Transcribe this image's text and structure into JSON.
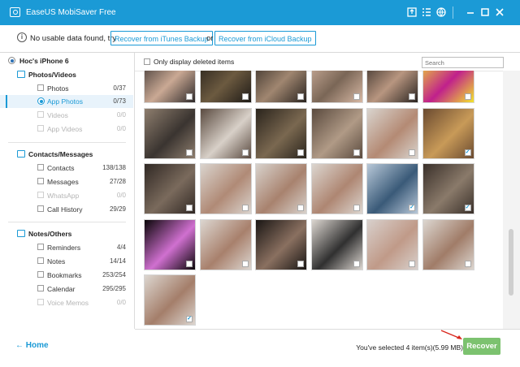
{
  "window": {
    "title": "EaseUS MobiSaver Free",
    "accent": "#1b9ad6"
  },
  "info_bar": {
    "message": "No usable data found, try",
    "itunes_button": "Recover from iTunes Backup",
    "or": "or",
    "icloud_button": "Recover from iCloud Backup"
  },
  "sidebar": {
    "device": "Hoc's iPhone 6",
    "groups": [
      {
        "name": "Photos/Videos",
        "icon": "photo-icon",
        "items": [
          {
            "label": "Photos",
            "count": "0/37",
            "enabled": true,
            "active": false
          },
          {
            "label": "App Photos",
            "count": "0/73",
            "enabled": true,
            "active": true
          },
          {
            "label": "Videos",
            "count": "0/0",
            "enabled": false,
            "active": false
          },
          {
            "label": "App Videos",
            "count": "0/0",
            "enabled": false,
            "active": false
          }
        ]
      },
      {
        "name": "Contacts/Messages",
        "icon": "contacts-icon",
        "items": [
          {
            "label": "Contacts",
            "count": "138/138",
            "enabled": true
          },
          {
            "label": "Messages",
            "count": "27/28",
            "enabled": true
          },
          {
            "label": "WhatsApp",
            "count": "0/0",
            "enabled": false
          },
          {
            "label": "Call History",
            "count": "29/29",
            "enabled": true
          }
        ]
      },
      {
        "name": "Notes/Others",
        "icon": "notes-icon",
        "items": [
          {
            "label": "Reminders",
            "count": "4/4",
            "enabled": true
          },
          {
            "label": "Notes",
            "count": "14/14",
            "enabled": true
          },
          {
            "label": "Bookmarks",
            "count": "253/254",
            "enabled": true
          },
          {
            "label": "Calendar",
            "count": "295/295",
            "enabled": true
          },
          {
            "label": "Voice Memos",
            "count": "0/0",
            "enabled": false
          }
        ]
      }
    ],
    "home_label": "Home"
  },
  "content": {
    "filter_label": "Only display deleted items",
    "search_placeholder": "Search",
    "thumbnails": [
      {
        "colors": [
          "#2e2a2a",
          "#caa994"
        ],
        "checked": false
      },
      {
        "colors": [
          "#1e1a16",
          "#6c5a40"
        ],
        "checked": false
      },
      {
        "colors": [
          "#2b2520",
          "#a08670"
        ],
        "checked": false
      },
      {
        "colors": [
          "#d7b8a4",
          "#7a6656"
        ],
        "checked": false
      },
      {
        "colors": [
          "#2a2420",
          "#b89680"
        ],
        "checked": false
      },
      {
        "colors": [
          "#f2e52b",
          "#c0208c"
        ],
        "checked": false
      },
      {
        "colors": [
          "#8e7e6e",
          "#3a3430"
        ],
        "checked": false
      },
      {
        "colors": [
          "#5a4a40",
          "#d8d0c8"
        ],
        "checked": false
      },
      {
        "colors": [
          "#2a241c",
          "#7a6850"
        ],
        "checked": false
      },
      {
        "colors": [
          "#5a4a3e",
          "#b09a86"
        ],
        "checked": false
      },
      {
        "colors": [
          "#d9d4ce",
          "#b48a74"
        ],
        "checked": false
      },
      {
        "colors": [
          "#6a4a30",
          "#c89a58"
        ],
        "checked": true
      },
      {
        "colors": [
          "#302824",
          "#7a6a5c"
        ],
        "checked": false
      },
      {
        "colors": [
          "#dad4ce",
          "#b08a76"
        ],
        "checked": false
      },
      {
        "colors": [
          "#d8d2cc",
          "#a8826e"
        ],
        "checked": false
      },
      {
        "colors": [
          "#dcd6d0",
          "#ae8672"
        ],
        "checked": false
      },
      {
        "colors": [
          "#b8c8d8",
          "#3a5a78"
        ],
        "checked": true
      },
      {
        "colors": [
          "#3a302a",
          "#8a7a6a"
        ],
        "checked": true
      },
      {
        "colors": [
          "#0a0608",
          "#d070d0"
        ],
        "checked": false
      },
      {
        "colors": [
          "#dcd6d0",
          "#a8806c"
        ],
        "checked": false
      },
      {
        "colors": [
          "#1a1614",
          "#8a7060"
        ],
        "checked": false
      },
      {
        "colors": [
          "#dcd6d0",
          "#303030"
        ],
        "checked": false
      },
      {
        "colors": [
          "#d8d0cc",
          "#c09a88"
        ],
        "checked": false
      },
      {
        "colors": [
          "#dcd6d0",
          "#a07c68"
        ],
        "checked": false
      },
      {
        "colors": [
          "#dcd6d0",
          "#a47e6a"
        ],
        "checked": true
      }
    ]
  },
  "footer": {
    "selected_text": "You've selected 4 item(s)(5.99 MB)",
    "recover_label": "Recover"
  }
}
